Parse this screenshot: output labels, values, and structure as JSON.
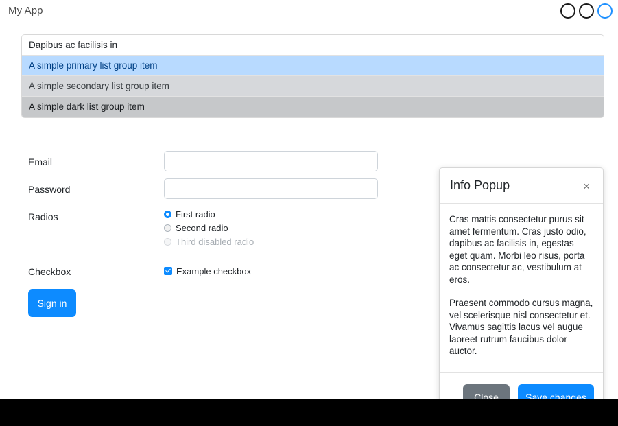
{
  "window": {
    "title": "My App",
    "controls": [
      {
        "name": "minimize-circle",
        "state": "normal"
      },
      {
        "name": "maximize-circle",
        "state": "normal"
      },
      {
        "name": "close-circle",
        "state": "active"
      }
    ]
  },
  "list_group": {
    "items": [
      {
        "label": "Dapibus ac facilisis in",
        "variant": "default"
      },
      {
        "label": "A simple primary list group item",
        "variant": "primary"
      },
      {
        "label": "A simple secondary list group item",
        "variant": "secondary"
      },
      {
        "label": "A simple dark list group item",
        "variant": "dark"
      }
    ]
  },
  "form": {
    "email": {
      "label": "Email",
      "value": "",
      "placeholder": ""
    },
    "password": {
      "label": "Password",
      "value": "",
      "placeholder": ""
    },
    "radios": {
      "label": "Radios",
      "options": [
        {
          "label": "First radio",
          "checked": true,
          "disabled": false
        },
        {
          "label": "Second radio",
          "checked": false,
          "disabled": false
        },
        {
          "label": "Third disabled radio",
          "checked": false,
          "disabled": true
        }
      ]
    },
    "checkbox": {
      "label": "Checkbox",
      "option_label": "Example checkbox",
      "checked": true
    },
    "submit_label": "Sign in"
  },
  "popup": {
    "title": "Info Popup",
    "close_icon": "×",
    "paragraphs": [
      "Cras mattis consectetur purus sit amet fermentum. Cras justo odio, dapibus ac facilisis in, egestas eget quam. Morbi leo risus, porta ac consectetur ac, vestibulum at eros.",
      "Praesent commodo cursus magna, vel scelerisque nisl consectetur et. Vivamus sagittis lacus vel augue laoreet rutrum faucibus dolor auctor."
    ],
    "close_label": "Close",
    "save_label": "Save changes"
  },
  "colors": {
    "accent": "#0d8bff",
    "secondary": "#6c757d",
    "list_primary_bg": "#b8daff",
    "list_secondary_bg": "#d6d8db",
    "list_dark_bg": "#c6c8ca",
    "page_background": "#000000"
  }
}
